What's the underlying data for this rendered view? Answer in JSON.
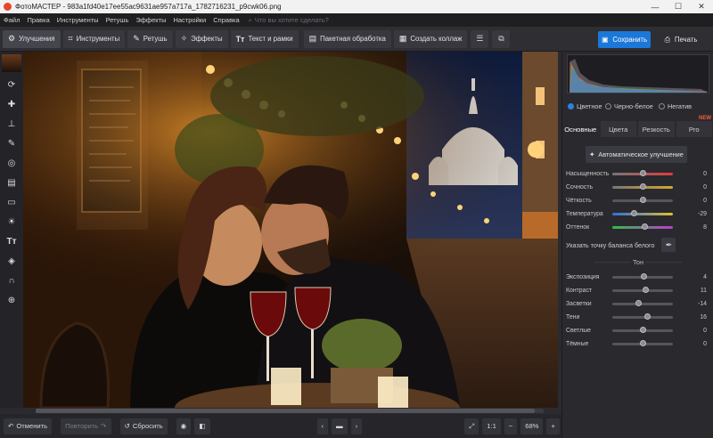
{
  "window": {
    "title": "ФотоМАСТЕР - 983a1fd40e17ee55ac9631ae957a717a_1782716231_p9cwk06.png"
  },
  "menu": {
    "items": [
      "Файл",
      "Правка",
      "Инструменты",
      "Ретушь",
      "Эффекты",
      "Настройки",
      "Справка"
    ],
    "search_placeholder": "Что вы хотите сделать?"
  },
  "toolbar": {
    "tabs": [
      "Улучшения",
      "Инструменты",
      "Ретушь",
      "Эффекты",
      "Текст и рамки"
    ],
    "batch": "Пакетная обработка",
    "collage": "Создать коллаж",
    "save": "Сохранить",
    "print": "Печать"
  },
  "panel": {
    "modes": [
      "Цветное",
      "Черно-белое",
      "Негатив"
    ],
    "tabs": [
      "Основные",
      "Цвета",
      "Резкость",
      "Pro"
    ],
    "new_badge": "NEW",
    "auto_button": "Автоматическое улучшение",
    "sliders": [
      {
        "label": "Насыщенность",
        "value": "0",
        "pos": 0.5
      },
      {
        "label": "Сочность",
        "value": "0",
        "pos": 0.5
      },
      {
        "label": "Чёткость",
        "value": "0",
        "pos": 0.5
      },
      {
        "label": "Температура",
        "value": "-29",
        "pos": 0.36
      },
      {
        "label": "Оттенок",
        "value": "8",
        "pos": 0.54
      }
    ],
    "white_balance": "Указать точку баланса белого",
    "tone_header": "Тон",
    "tone_sliders": [
      {
        "label": "Экспозиция",
        "value": "4",
        "pos": 0.52
      },
      {
        "label": "Контраст",
        "value": "11",
        "pos": 0.55
      },
      {
        "label": "Засветки",
        "value": "-14",
        "pos": 0.43
      },
      {
        "label": "Тени",
        "value": "16",
        "pos": 0.58
      },
      {
        "label": "Светлые",
        "value": "0",
        "pos": 0.5
      },
      {
        "label": "Тёмные",
        "value": "0",
        "pos": 0.5
      }
    ]
  },
  "bottom": {
    "undo": "Отменить",
    "redo": "Повторить",
    "reset": "Сбросить",
    "zoom_ratio": "1:1",
    "zoom": "68%"
  },
  "colors": {
    "accent": "#1b78d8",
    "new_badge": "#ff5a3c"
  }
}
